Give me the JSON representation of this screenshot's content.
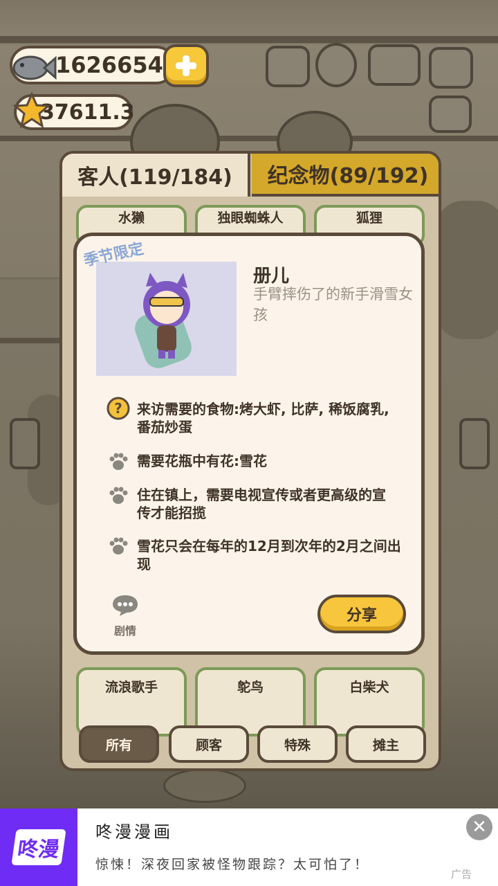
{
  "currency": {
    "fish": "1626654",
    "stars": "37611.3"
  },
  "tabs": {
    "customers": "客人(119/184)",
    "souvenirs": "纪念物(89/192)"
  },
  "grid_top": [
    "水獭",
    "独眼蜘蛛人",
    "狐狸"
  ],
  "grid_bottom": [
    "流浪歌手",
    "鸵鸟",
    "白柴犬"
  ],
  "filters": [
    "所有",
    "顾客",
    "特殊",
    "摊主"
  ],
  "detail": {
    "season_tag": "季节限定",
    "name": "册儿",
    "description": "手臂摔伤了的新手滑雪女孩",
    "requirements": [
      {
        "icon": "question-icon",
        "text": "来访需要的食物:烤大虾, 比萨, 稀饭腐乳, 番茄炒蛋"
      },
      {
        "icon": "paw-icon",
        "text": "需要花瓶中有花:雪花"
      },
      {
        "icon": "paw-icon",
        "text": "住在镇上，需要电视宣传或者更高级的宣传才能招揽"
      },
      {
        "icon": "paw-icon",
        "text": "雪花只会在每年的12月到次年的2月之间出现"
      }
    ],
    "story_label": "剧情",
    "share_label": "分享"
  },
  "ad": {
    "logo": "咚漫",
    "title": "咚漫漫画",
    "subtitle": "惊悚！深夜回家被怪物跟踪？太可怕了！",
    "tag": "广告",
    "close": "✕"
  },
  "colors": {
    "accent_yellow": "#f8c63c",
    "panel_border": "#5a4a3a",
    "card_green": "#7d9a58",
    "ad_purple": "#6f2cf4"
  }
}
